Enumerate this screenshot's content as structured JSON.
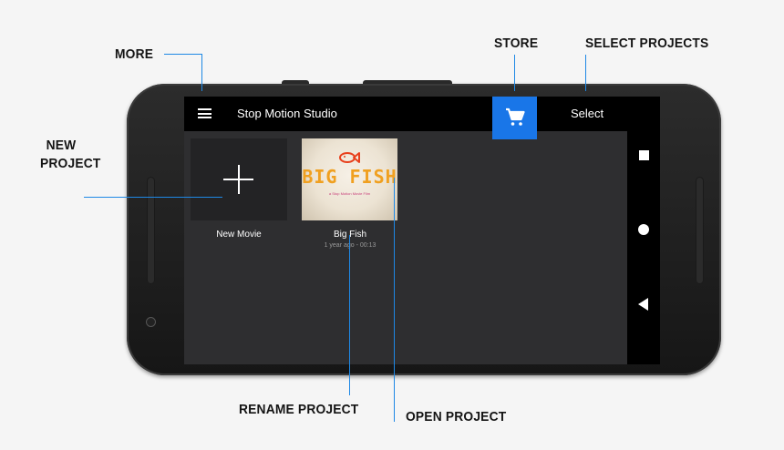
{
  "callouts": {
    "more": "MORE",
    "store": "STORE",
    "select_projects": "SELECT PROJECTS",
    "new_project_line1": "NEW",
    "new_project_line2": "PROJECT",
    "rename_project": "RENAME PROJECT",
    "open_project": "OPEN PROJECT"
  },
  "app": {
    "title": "Stop Motion Studio",
    "menu_icon": "hamburger-menu-icon",
    "store_icon": "shopping-cart-icon",
    "select_label": "Select"
  },
  "projects": [
    {
      "label": "New Movie",
      "icon": "plus-icon"
    },
    {
      "label": "Big Fish",
      "meta": "1 year ago - 00:13",
      "thumbnail_title": "BIG FISH",
      "thumbnail_subtitle": "a Stop Motion Movie Film"
    }
  ],
  "navbar": {
    "icons": [
      "recent-apps-icon",
      "home-icon",
      "back-icon"
    ]
  },
  "colors": {
    "accent": "#1976e8",
    "callout_line": "#1e88e5",
    "screen_bg": "#2e2e30"
  }
}
